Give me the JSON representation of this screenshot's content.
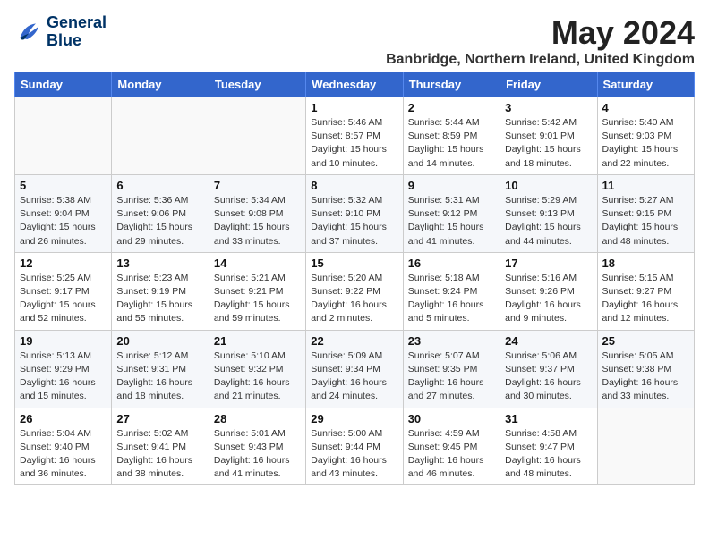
{
  "logo": {
    "line1": "General",
    "line2": "Blue"
  },
  "title": "May 2024",
  "subtitle": "Banbridge, Northern Ireland, United Kingdom",
  "days_header": [
    "Sunday",
    "Monday",
    "Tuesday",
    "Wednesday",
    "Thursday",
    "Friday",
    "Saturday"
  ],
  "weeks": [
    [
      {
        "day": "",
        "info": ""
      },
      {
        "day": "",
        "info": ""
      },
      {
        "day": "",
        "info": ""
      },
      {
        "day": "1",
        "info": "Sunrise: 5:46 AM\nSunset: 8:57 PM\nDaylight: 15 hours\nand 10 minutes."
      },
      {
        "day": "2",
        "info": "Sunrise: 5:44 AM\nSunset: 8:59 PM\nDaylight: 15 hours\nand 14 minutes."
      },
      {
        "day": "3",
        "info": "Sunrise: 5:42 AM\nSunset: 9:01 PM\nDaylight: 15 hours\nand 18 minutes."
      },
      {
        "day": "4",
        "info": "Sunrise: 5:40 AM\nSunset: 9:03 PM\nDaylight: 15 hours\nand 22 minutes."
      }
    ],
    [
      {
        "day": "5",
        "info": "Sunrise: 5:38 AM\nSunset: 9:04 PM\nDaylight: 15 hours\nand 26 minutes."
      },
      {
        "day": "6",
        "info": "Sunrise: 5:36 AM\nSunset: 9:06 PM\nDaylight: 15 hours\nand 29 minutes."
      },
      {
        "day": "7",
        "info": "Sunrise: 5:34 AM\nSunset: 9:08 PM\nDaylight: 15 hours\nand 33 minutes."
      },
      {
        "day": "8",
        "info": "Sunrise: 5:32 AM\nSunset: 9:10 PM\nDaylight: 15 hours\nand 37 minutes."
      },
      {
        "day": "9",
        "info": "Sunrise: 5:31 AM\nSunset: 9:12 PM\nDaylight: 15 hours\nand 41 minutes."
      },
      {
        "day": "10",
        "info": "Sunrise: 5:29 AM\nSunset: 9:13 PM\nDaylight: 15 hours\nand 44 minutes."
      },
      {
        "day": "11",
        "info": "Sunrise: 5:27 AM\nSunset: 9:15 PM\nDaylight: 15 hours\nand 48 minutes."
      }
    ],
    [
      {
        "day": "12",
        "info": "Sunrise: 5:25 AM\nSunset: 9:17 PM\nDaylight: 15 hours\nand 52 minutes."
      },
      {
        "day": "13",
        "info": "Sunrise: 5:23 AM\nSunset: 9:19 PM\nDaylight: 15 hours\nand 55 minutes."
      },
      {
        "day": "14",
        "info": "Sunrise: 5:21 AM\nSunset: 9:21 PM\nDaylight: 15 hours\nand 59 minutes."
      },
      {
        "day": "15",
        "info": "Sunrise: 5:20 AM\nSunset: 9:22 PM\nDaylight: 16 hours\nand 2 minutes."
      },
      {
        "day": "16",
        "info": "Sunrise: 5:18 AM\nSunset: 9:24 PM\nDaylight: 16 hours\nand 5 minutes."
      },
      {
        "day": "17",
        "info": "Sunrise: 5:16 AM\nSunset: 9:26 PM\nDaylight: 16 hours\nand 9 minutes."
      },
      {
        "day": "18",
        "info": "Sunrise: 5:15 AM\nSunset: 9:27 PM\nDaylight: 16 hours\nand 12 minutes."
      }
    ],
    [
      {
        "day": "19",
        "info": "Sunrise: 5:13 AM\nSunset: 9:29 PM\nDaylight: 16 hours\nand 15 minutes."
      },
      {
        "day": "20",
        "info": "Sunrise: 5:12 AM\nSunset: 9:31 PM\nDaylight: 16 hours\nand 18 minutes."
      },
      {
        "day": "21",
        "info": "Sunrise: 5:10 AM\nSunset: 9:32 PM\nDaylight: 16 hours\nand 21 minutes."
      },
      {
        "day": "22",
        "info": "Sunrise: 5:09 AM\nSunset: 9:34 PM\nDaylight: 16 hours\nand 24 minutes."
      },
      {
        "day": "23",
        "info": "Sunrise: 5:07 AM\nSunset: 9:35 PM\nDaylight: 16 hours\nand 27 minutes."
      },
      {
        "day": "24",
        "info": "Sunrise: 5:06 AM\nSunset: 9:37 PM\nDaylight: 16 hours\nand 30 minutes."
      },
      {
        "day": "25",
        "info": "Sunrise: 5:05 AM\nSunset: 9:38 PM\nDaylight: 16 hours\nand 33 minutes."
      }
    ],
    [
      {
        "day": "26",
        "info": "Sunrise: 5:04 AM\nSunset: 9:40 PM\nDaylight: 16 hours\nand 36 minutes."
      },
      {
        "day": "27",
        "info": "Sunrise: 5:02 AM\nSunset: 9:41 PM\nDaylight: 16 hours\nand 38 minutes."
      },
      {
        "day": "28",
        "info": "Sunrise: 5:01 AM\nSunset: 9:43 PM\nDaylight: 16 hours\nand 41 minutes."
      },
      {
        "day": "29",
        "info": "Sunrise: 5:00 AM\nSunset: 9:44 PM\nDaylight: 16 hours\nand 43 minutes."
      },
      {
        "day": "30",
        "info": "Sunrise: 4:59 AM\nSunset: 9:45 PM\nDaylight: 16 hours\nand 46 minutes."
      },
      {
        "day": "31",
        "info": "Sunrise: 4:58 AM\nSunset: 9:47 PM\nDaylight: 16 hours\nand 48 minutes."
      },
      {
        "day": "",
        "info": ""
      }
    ]
  ]
}
